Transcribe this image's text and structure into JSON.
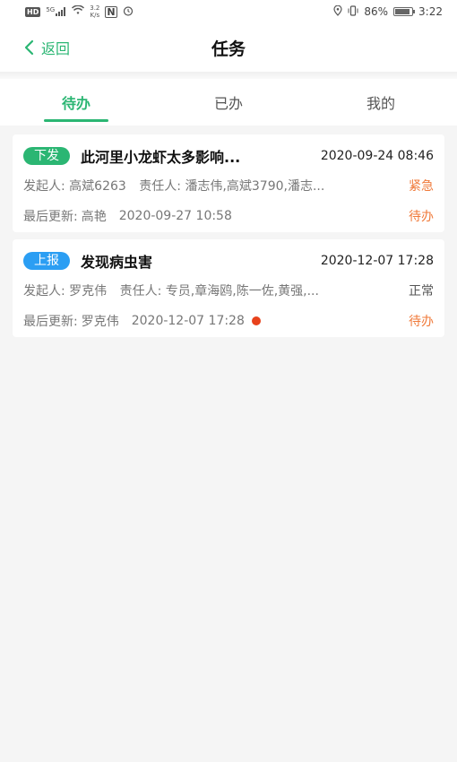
{
  "status_bar": {
    "hd_chip": "HD",
    "network": "5G",
    "speed_value": "3.2",
    "speed_unit": "K/s",
    "nfc": "N",
    "battery": "86%",
    "battery_fill": 0.86,
    "time": "3:22"
  },
  "header": {
    "back_label": "返回",
    "title": "任务"
  },
  "tabs": [
    {
      "label": "待办",
      "active": true
    },
    {
      "label": "已办",
      "active": false
    },
    {
      "label": "我的",
      "active": false
    }
  ],
  "tasks": [
    {
      "tag": "下发",
      "tag_color": "#2bb673",
      "title": "此河里小龙虾太多影响...",
      "time": "2020-09-24 08:46",
      "initiator_label": "发起人:",
      "initiator": "高斌6263",
      "assignee_label": "责任人:",
      "assignees": "潘志伟,高斌3790,潘志...",
      "priority": "紧急",
      "updated_label": "最后更新:",
      "updated_by": "高艳",
      "updated_time": "2020-09-27 10:58",
      "status": "待办",
      "unread": false
    },
    {
      "tag": "上报",
      "tag_color": "#2b9ef3",
      "title": "发现病虫害",
      "time": "2020-12-07 17:28",
      "initiator_label": "发起人:",
      "initiator": "罗克伟",
      "assignee_label": "责任人:",
      "assignees": "专员,章海鸥,陈一佐,黄强,...",
      "priority": "正常",
      "updated_label": "最后更新:",
      "updated_by": "罗克伟",
      "updated_time": "2020-12-07 17:28",
      "status": "待办",
      "unread": true
    }
  ]
}
